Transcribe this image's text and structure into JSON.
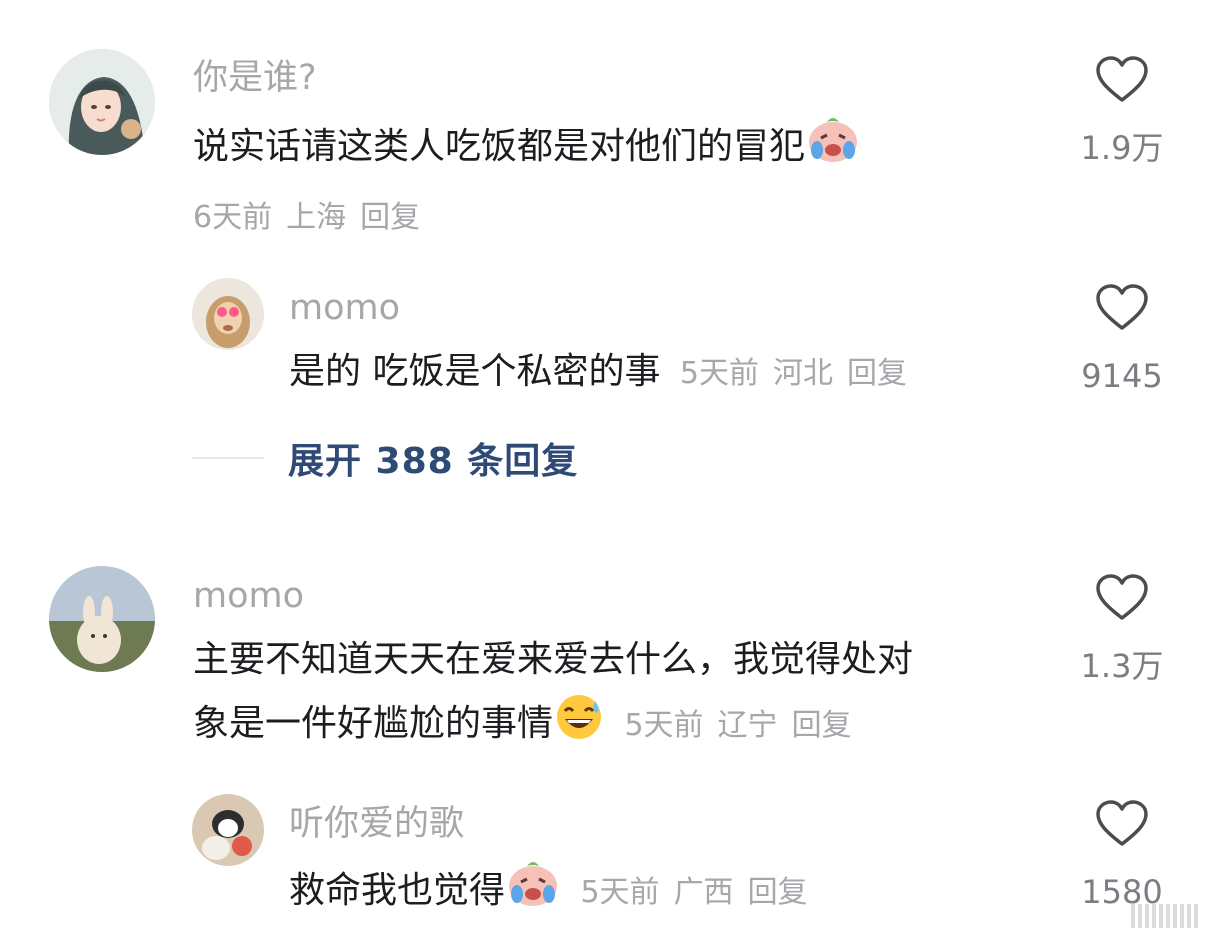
{
  "comments": [
    {
      "username": "你是谁?",
      "text": "说实话请这类人吃饭都是对他们的冒犯",
      "emoji": "crying-laughing-peach-emoji",
      "time": "6天前",
      "location": "上海",
      "reply_label": "回复",
      "likes": "1.9万",
      "replies": [
        {
          "username": "momo",
          "text": "是的 吃饭是个私密的事",
          "time": "5天前",
          "location": "河北",
          "reply_label": "回复",
          "likes": "9145"
        }
      ],
      "expand_label": "展开 388 条回复"
    },
    {
      "username": "momo",
      "text_line1": "主要不知道天天在爱来爱去什么，我觉得处对",
      "text_line2": "象是一件好尴尬的事情",
      "emoji": "grinning-sweat-emoji",
      "time": "5天前",
      "location": "辽宁",
      "reply_label": "回复",
      "likes": "1.3万",
      "replies": [
        {
          "username": "听你爱的歌",
          "text": "救命我也觉得",
          "emoji": "crying-laughing-peach-emoji",
          "time": "5天前",
          "location": "广西",
          "reply_label": "回复",
          "likes": "1580"
        }
      ]
    }
  ],
  "colors": {
    "username": "#a5a7ab",
    "text": "#1c1d21",
    "expand_link": "#2e4a75",
    "like_count": "#7b7d83"
  }
}
